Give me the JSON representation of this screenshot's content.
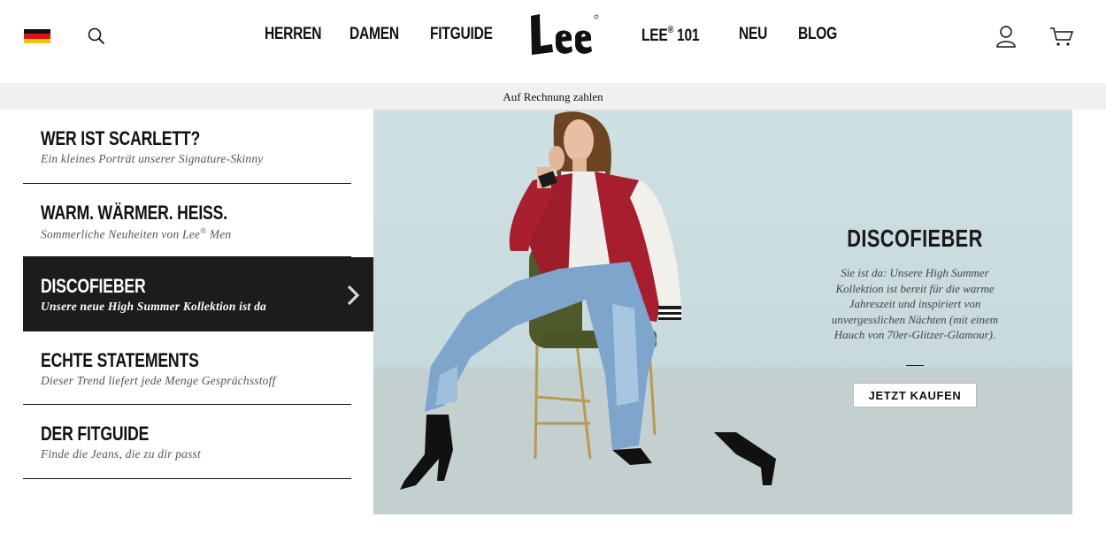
{
  "header": {
    "flag_icon": "germany-flag-icon",
    "search_icon": "search-icon",
    "nav": [
      {
        "label": "HERREN"
      },
      {
        "label": "DAMEN"
      },
      {
        "label": "FITGUIDE"
      },
      {
        "label": "LEE",
        "sup": "®",
        "suffix": " 101"
      },
      {
        "label": "NEU"
      },
      {
        "label": "BLOG"
      }
    ],
    "logo_text": "Lee",
    "account_icon": "user-icon",
    "cart_icon": "cart-icon"
  },
  "promo": {
    "text": "Auf Rechnung zahlen"
  },
  "stories": [
    {
      "title": "WER IST SCARLETT?",
      "subtitle": "Ein kleines Porträt unserer Signature-Skinny",
      "active": false
    },
    {
      "title": "WARM. WÄRMER. HEISS.",
      "subtitle_pre": "Sommerliche Neuheiten von Lee",
      "subtitle_sup": "®",
      "subtitle_post": " Men",
      "active": false
    },
    {
      "title": "DISCOFIEBER",
      "subtitle": "Unsere neue High Summer Kollektion ist da",
      "active": true
    },
    {
      "title": "ECHTE STATEMENTS",
      "subtitle": "Dieser Trend liefert jede Menge Gesprächsstoff",
      "active": false
    },
    {
      "title": "DER FITGUIDE",
      "subtitle": "Finde die Jeans, die zu dir passt",
      "active": false
    }
  ],
  "hero": {
    "title": "DISCOFIEBER",
    "text": "Sie ist da: Unsere High Summer Kollektion ist bereit für die warme Jahreszeit und inspiriert von unvergesslichen Nächten (mit einem Hauch von 70er-Glitzer-Glamour).",
    "button": "JETZT KAUFEN"
  },
  "colors": {
    "active_bg": "#1c1c1c",
    "promo_bg": "#f0f0f0",
    "jacket_red": "#9e1d2b",
    "denim": "#7ea5cc"
  }
}
